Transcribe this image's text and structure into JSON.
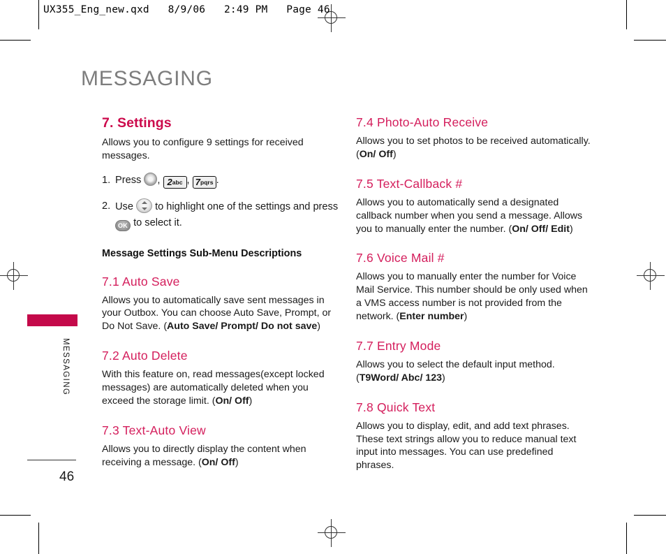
{
  "slug": {
    "text": "UX355_Eng_new.qxd   8/9/06   2:49 PM   Page 46"
  },
  "page": {
    "title": "MESSAGING",
    "side_label": "MESSAGING",
    "number": "46",
    "accent_color": "#cc0a4c",
    "tab_color": "#c4094a",
    "title_color": "#7d7d7d"
  },
  "left_column": {
    "section_title": "7. Settings",
    "intro": "Allows you to configure 9 settings for received messages.",
    "steps": [
      {
        "num": "1.",
        "pre": "Press",
        "post": ".",
        "keys": [
          {
            "type": "round",
            "name": "menu-key-icon"
          },
          {
            "type": "box",
            "digit": "2",
            "letters": "abc",
            "name": "key-2abc-icon"
          },
          {
            "type": "box",
            "digit": "7",
            "letters": "pqrs",
            "name": "key-7pqrs-icon"
          }
        ]
      },
      {
        "num": "2.",
        "pre": "Use",
        "mid": "to highlight one of the settings and press",
        "post": "to select it.",
        "keys": [
          {
            "type": "nav",
            "name": "navigation-key-icon"
          },
          {
            "type": "ok",
            "label": "OK",
            "name": "ok-key-icon"
          }
        ]
      }
    ],
    "subhead": "Message Settings Sub-Menu Descriptions",
    "subsections": [
      {
        "title": "7.1 Auto Save",
        "body_plain": "Allows you to automatically save sent messages in your Outbox. You can choose Auto Save, Prompt, or Do Not Save. (",
        "body_bold": "Auto Save/ Prompt/ Do not save",
        "body_tail": ")"
      },
      {
        "title": "7.2 Auto Delete",
        "body_plain": "With this feature on, read messages(except locked messages) are automatically deleted when you exceed the storage limit. (",
        "body_bold": "On/ Off",
        "body_tail": ")"
      },
      {
        "title": "7.3 Text-Auto View",
        "body_plain": "Allows you to directly display the content when receiving a message. (",
        "body_bold": "On/ Off",
        "body_tail": ")"
      }
    ]
  },
  "right_column": {
    "subsections": [
      {
        "title": "7.4 Photo-Auto Receive",
        "body_plain": "Allows you to set photos to be received automatically. (",
        "body_bold": "On/ Off",
        "body_tail": ")"
      },
      {
        "title": "7.5 Text-Callback #",
        "body_plain": "Allows you to automatically send a designated callback number when you send a message. Allows you to manually enter the number. (",
        "body_bold": "On/ Off/ Edit",
        "body_tail": ")"
      },
      {
        "title": "7.6 Voice Mail #",
        "body_plain": "Allows you to manually enter the number for Voice Mail Service. This number should be only used when a VMS access number is not provided from the network. (",
        "body_bold": "Enter number",
        "body_tail": ")"
      },
      {
        "title": "7.7 Entry Mode",
        "body_plain": "Allows you to select the default input method. (",
        "body_bold": "T9Word/ Abc/ 123",
        "body_tail": ")"
      },
      {
        "title": "7.8 Quick Text",
        "body_plain": "Allows you to display, edit, and add text phrases. These text strings allow you to reduce manual text input into messages. You can use predefined phrases.",
        "body_bold": "",
        "body_tail": ""
      }
    ]
  }
}
